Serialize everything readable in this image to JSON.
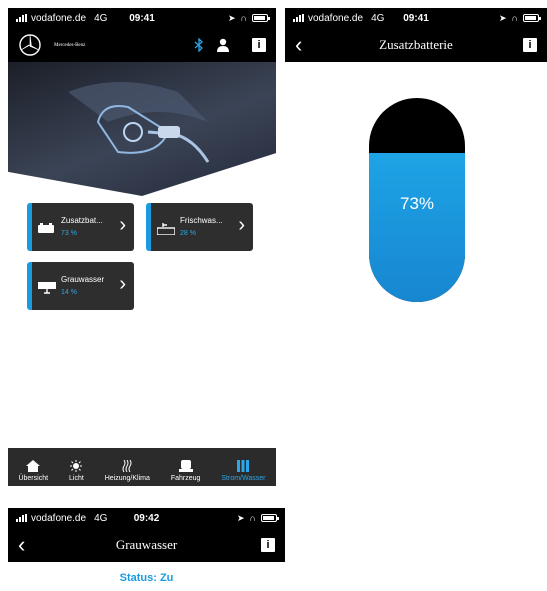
{
  "status_bar_main": {
    "carrier": "vodafone.de",
    "network": "4G",
    "time": "09:41"
  },
  "status_bar_gauge": {
    "carrier": "vodafone.de",
    "network": "4G",
    "time": "09:41"
  },
  "status_bar_bottom": {
    "carrier": "vodafone.de",
    "network": "4G",
    "time": "09:42"
  },
  "main": {
    "brand_label": "Mercedes-Benz",
    "info_label": "i",
    "tiles": [
      {
        "name": "Zusatzbat...",
        "value": "73 %",
        "icon": "battery-icon"
      },
      {
        "name": "Frischwas...",
        "value": "28 %",
        "icon": "fresh-water-tank-icon"
      },
      {
        "name": "Grauwasser",
        "value": "14 %",
        "icon": "grey-water-tank-icon"
      }
    ],
    "nav": [
      {
        "label": "Übersicht",
        "icon": "home-icon"
      },
      {
        "label": "Licht",
        "icon": "light-icon"
      },
      {
        "label": "Heizung/Klima",
        "icon": "heating-icon"
      },
      {
        "label": "Fahrzeug",
        "icon": "vehicle-icon"
      },
      {
        "label": "Strom/Wasser",
        "icon": "power-water-icon",
        "active": true
      }
    ]
  },
  "gauge_screen": {
    "title": "Zusatzbatterie",
    "back_label": "‹",
    "info_label": "i",
    "level_text": "73%",
    "level_fraction": 0.73
  },
  "bottom_screen": {
    "title": "Grauwasser",
    "back_label": "‹",
    "info_label": "i",
    "status_text": "Status: Zu"
  },
  "colors": {
    "accent": "#1a9be0",
    "bar_bg": "#000000",
    "tile_bg": "#2e2e2e"
  }
}
